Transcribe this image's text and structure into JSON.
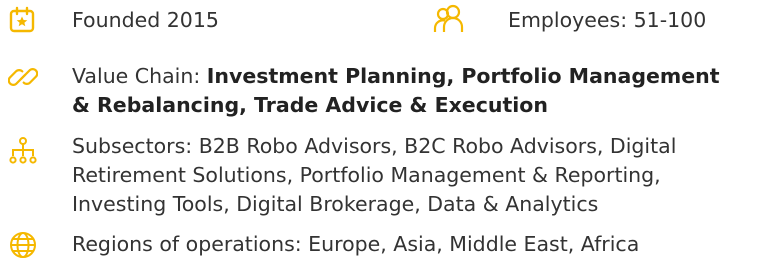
{
  "accent_color": "#F5B800",
  "founded": {
    "icon": "calendar-star-icon",
    "text": "Founded 2015"
  },
  "employees": {
    "icon": "people-icon",
    "text": "Employees: 51-100"
  },
  "value_chain": {
    "icon": "link-icon",
    "prefix": "Value Chain: ",
    "items_line1": "Investment Planning, Portfolio Management",
    "items_line2": "& Rebalancing, Trade Advice & Execution"
  },
  "subsectors": {
    "icon": "hierarchy-icon",
    "line1": "Subsectors: B2B Robo Advisors, B2C Robo Advisors, Digital",
    "line2": "Retirement Solutions, Portfolio Management & Reporting,",
    "line3": "Investing Tools, Digital Brokerage, Data & Analytics"
  },
  "regions": {
    "icon": "globe-icon",
    "text": "Regions of operations: Europe, Asia, Middle East, Africa"
  }
}
